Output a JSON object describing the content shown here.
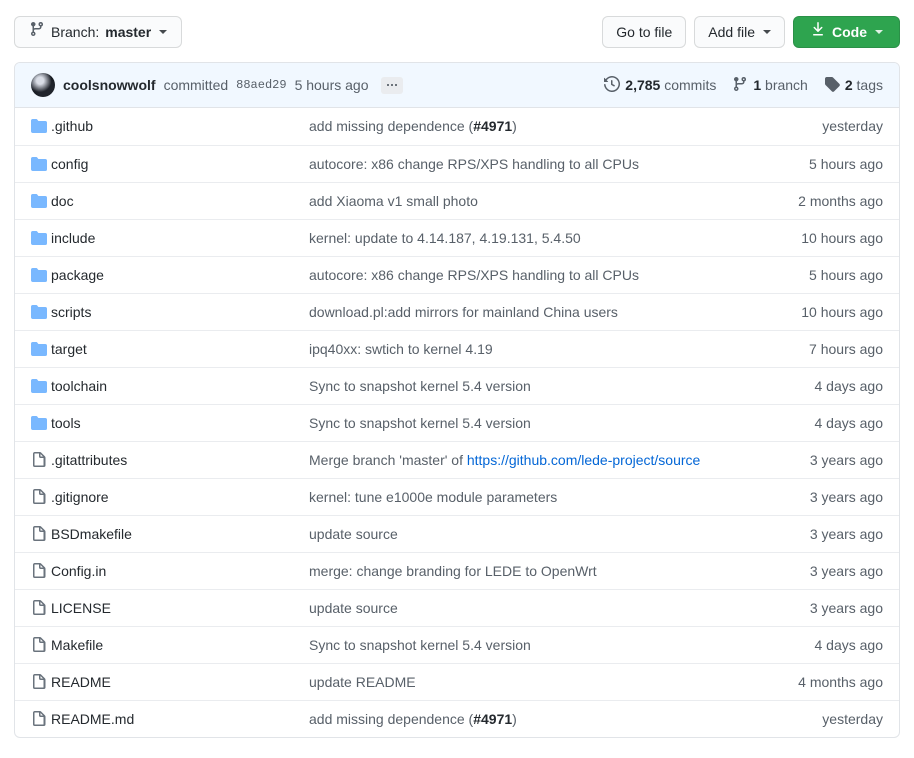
{
  "toolbar": {
    "branch_prefix": "Branch:",
    "branch_name": "master",
    "branch_icon": "git-branch-icon",
    "go_to_file_label": "Go to file",
    "add_file_label": "Add file",
    "code_label": "Code",
    "code_icon": "download-icon"
  },
  "commit_bar": {
    "avatar_name": "coolsnowwolf",
    "author": "coolsnowwolf",
    "verb": "committed",
    "sha": "88aed29",
    "time": "5 hours ago",
    "more_label": "…",
    "commits_count": "2,785",
    "commits_label": "commits",
    "branches_count": "1",
    "branches_label": "branch",
    "tags_count": "2",
    "tags_label": "tags",
    "background": "#f1f8ff"
  },
  "colors": {
    "folder": "#79b8ff",
    "file": "#6a737d",
    "link": "#0366d6",
    "green": "#2ea44f",
    "border": "#e1e4e8",
    "row_border": "#eaecef",
    "text": "#24292e",
    "muted": "#586069"
  },
  "files": [
    {
      "type": "folder",
      "name": ".github",
      "message": "add missing dependence (",
      "issue": "#4971",
      "message_tail": ")",
      "age": "yesterday"
    },
    {
      "type": "folder",
      "name": "config",
      "message": "autocore: x86 change RPS/XPS handling to all CPUs",
      "age": "5 hours ago"
    },
    {
      "type": "folder",
      "name": "doc",
      "message": "add Xiaoma v1 small photo",
      "age": "2 months ago"
    },
    {
      "type": "folder",
      "name": "include",
      "message": "kernel: update to 4.14.187, 4.19.131, 5.4.50",
      "age": "10 hours ago"
    },
    {
      "type": "folder",
      "name": "package",
      "message": "autocore: x86 change RPS/XPS handling to all CPUs",
      "age": "5 hours ago"
    },
    {
      "type": "folder",
      "name": "scripts",
      "message": "download.pl:add mirrors for mainland China users",
      "age": "10 hours ago"
    },
    {
      "type": "folder",
      "name": "target",
      "message": "ipq40xx: swtich to kernel 4.19",
      "age": "7 hours ago"
    },
    {
      "type": "folder",
      "name": "toolchain",
      "message": "Sync to snapshot kernel 5.4 version",
      "age": "4 days ago"
    },
    {
      "type": "folder",
      "name": "tools",
      "message": "Sync to snapshot kernel 5.4 version",
      "age": "4 days ago"
    },
    {
      "type": "file",
      "name": ".gitattributes",
      "message": "Merge branch 'master' of ",
      "url": "https://github.com/lede-project/source",
      "age": "3 years ago"
    },
    {
      "type": "file",
      "name": ".gitignore",
      "message": "kernel: tune e1000e module parameters",
      "age": "3 years ago"
    },
    {
      "type": "file",
      "name": "BSDmakefile",
      "message": "update source",
      "age": "3 years ago"
    },
    {
      "type": "file",
      "name": "Config.in",
      "message": "merge: change branding for LEDE to OpenWrt",
      "age": "3 years ago"
    },
    {
      "type": "file",
      "name": "LICENSE",
      "message": "update source",
      "age": "3 years ago"
    },
    {
      "type": "file",
      "name": "Makefile",
      "message": "Sync to snapshot kernel 5.4 version",
      "age": "4 days ago"
    },
    {
      "type": "file",
      "name": "README",
      "message": "update README",
      "age": "4 months ago"
    },
    {
      "type": "file",
      "name": "README.md",
      "message": "add missing dependence (",
      "issue": "#4971",
      "message_tail": ")",
      "age": "yesterday"
    }
  ]
}
